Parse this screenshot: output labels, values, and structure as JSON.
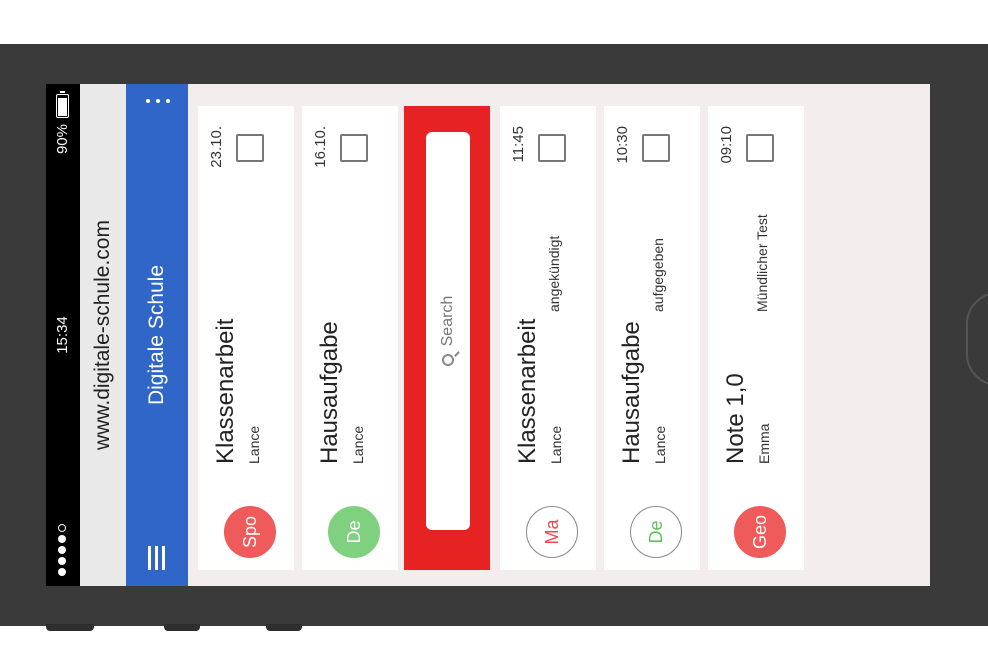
{
  "status_bar": {
    "time": "15:34",
    "battery": "90%"
  },
  "browser": {
    "url": "www.digitale-schule.com"
  },
  "app_bar": {
    "title": "Digitale Schule"
  },
  "search": {
    "placeholder": "Search"
  },
  "cards": [
    {
      "avatar": "Spo",
      "title": "Klassenarbeit",
      "subtitle": "Lance",
      "status": "",
      "date": "23.10.",
      "avatar_bg": "#ef5a5a",
      "avatar_fg": "#ffffff",
      "avatar_border": "#ef5a5a"
    },
    {
      "avatar": "De",
      "title": "Hausaufgabe",
      "subtitle": "Lance",
      "status": "",
      "date": "16.10.",
      "avatar_bg": "#7fd17f",
      "avatar_fg": "#ffffff",
      "avatar_border": "#7fd17f"
    },
    {
      "avatar": "Ma",
      "title": "Klassenarbeit",
      "subtitle": "Lance",
      "status": "angekündigt",
      "date": "11:45",
      "avatar_bg": "#ffffff",
      "avatar_fg": "#e84a4a",
      "avatar_border": "#888888"
    },
    {
      "avatar": "De",
      "title": "Hausaufgabe",
      "subtitle": "Lance",
      "status": "aufgegeben",
      "date": "10:30",
      "avatar_bg": "#ffffff",
      "avatar_fg": "#5cc35c",
      "avatar_border": "#888888"
    },
    {
      "avatar": "Geo",
      "title": "Note 1,0",
      "subtitle": "Emma",
      "status": "Mündlicher Test",
      "date": "09:10",
      "avatar_bg": "#ef5a5a",
      "avatar_fg": "#ffffff",
      "avatar_border": "#ef5a5a"
    }
  ],
  "colors": {
    "app_bar": "#2f66c8",
    "search_highlight": "#e62222",
    "background": "#f3eded"
  },
  "icons": [
    "signal-dots-icon",
    "battery-icon",
    "menu-icon",
    "more-vert-icon",
    "search-icon",
    "checkbox-icon"
  ]
}
